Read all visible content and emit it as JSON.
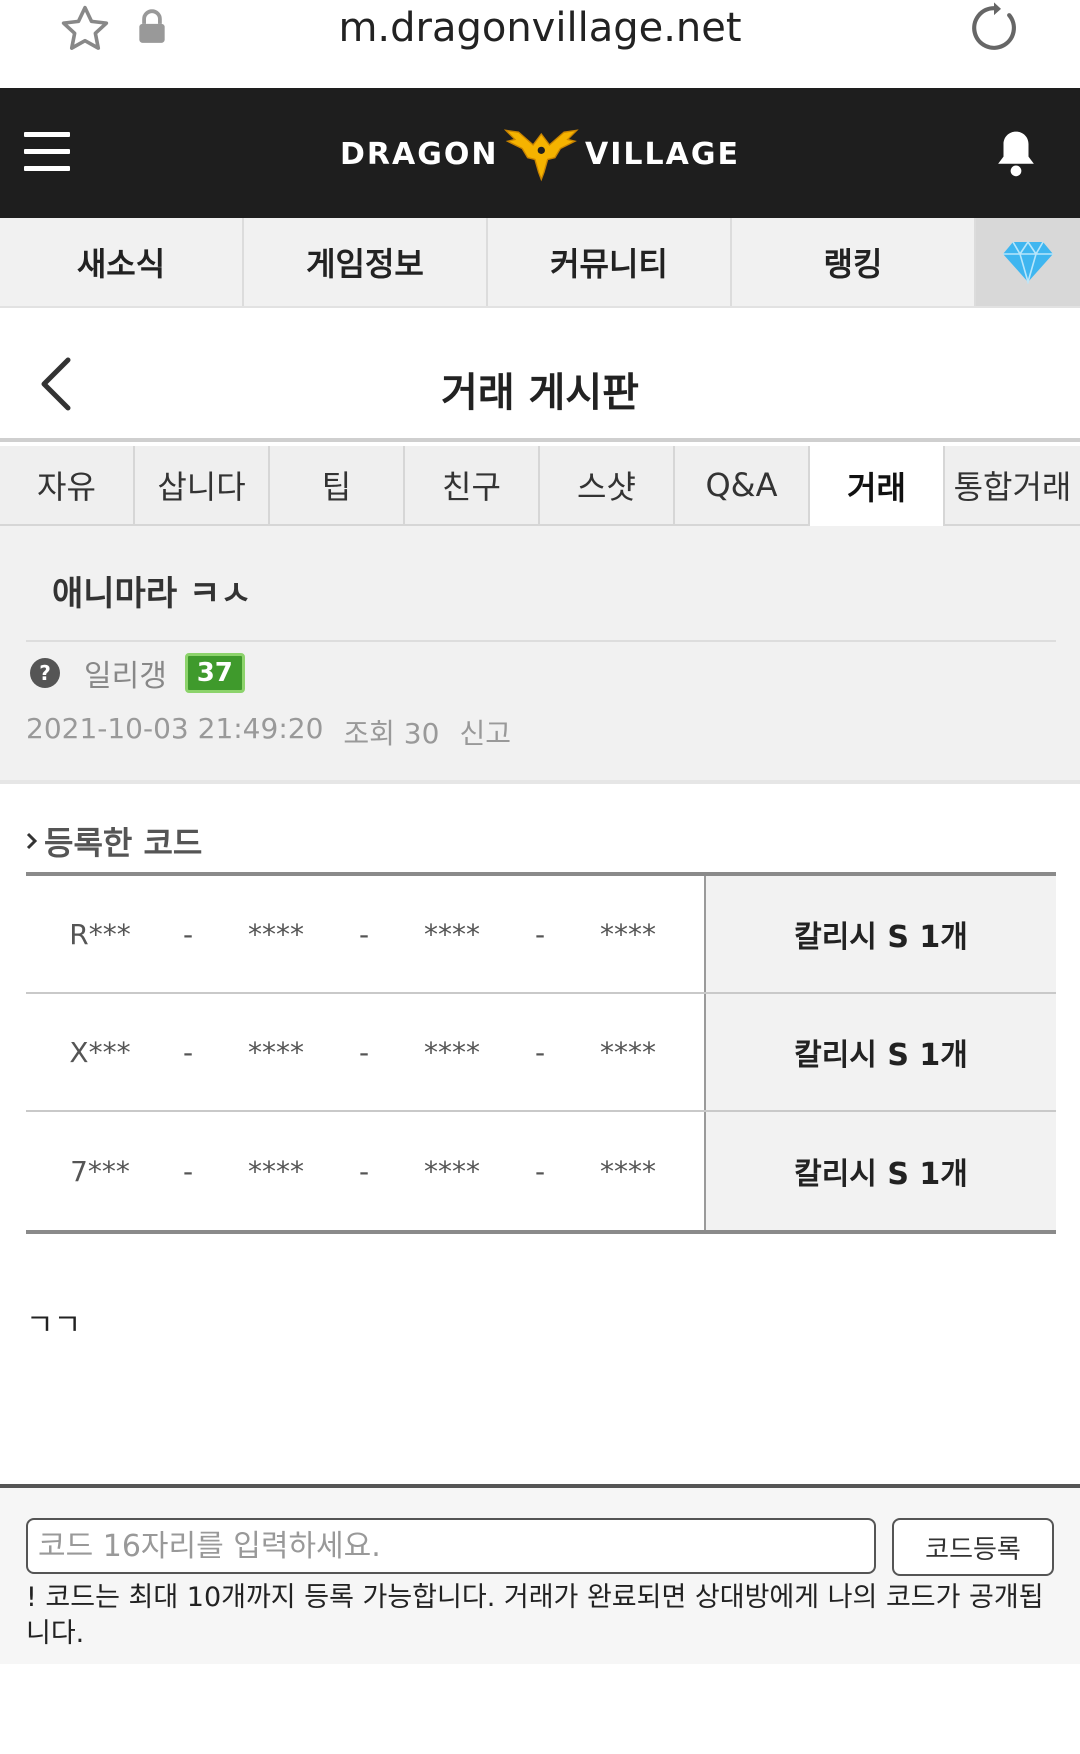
{
  "browser": {
    "url": "m.dragonvillage.net"
  },
  "header": {
    "logo_left": "DRAGON",
    "logo_right": "VILLAGE"
  },
  "main_nav": {
    "items": [
      "새소식",
      "게임정보",
      "커뮤니티",
      "랭킹"
    ]
  },
  "page": {
    "title": "거래 게시판"
  },
  "board_tabs": {
    "items": [
      "자유",
      "삽니다",
      "팁",
      "친구",
      "스샷",
      "Q&A",
      "거래",
      "통합거래"
    ],
    "active": "거래"
  },
  "post": {
    "title": "애니마라 ㅋㅅ",
    "author": "일리갱",
    "level": "37",
    "datetime": "2021-10-03 21:49:20",
    "views": "조회 30",
    "report": "신고",
    "body": "ㄱㄱ"
  },
  "codes": {
    "label": "등록한 코드",
    "rows": [
      {
        "seg1": "R***",
        "seg2": "****",
        "seg3": "****",
        "seg4": "****",
        "dash": "-",
        "reward": "칼리시 S 1개"
      },
      {
        "seg1": "X***",
        "seg2": "****",
        "seg3": "****",
        "seg4": "****",
        "dash": "-",
        "reward": "칼리시 S 1개"
      },
      {
        "seg1": "7***",
        "seg2": "****",
        "seg3": "****",
        "seg4": "****",
        "dash": "-",
        "reward": "칼리시 S 1개"
      }
    ]
  },
  "code_form": {
    "placeholder": "코드 16자리를 입력하세요.",
    "value": "",
    "button": "코드등록",
    "note": "! 코드는 최대 10개까지 등록 가능합니다. 거래가 완료되면 상대방에게 나의 코드가 공개됩니다."
  },
  "icons": {
    "bookmark": "star-icon",
    "secure": "lock-icon",
    "reload": "reload-icon",
    "menu": "hamburger-menu-icon",
    "notifications": "bell-icon",
    "premium": "diamond-icon",
    "back": "chevron-left-icon",
    "author_badge": "question-icon"
  },
  "colors": {
    "header_bg": "#1e1e1e",
    "logo_emblem": "#f5b300",
    "level_badge": "#3f9a2c",
    "diamond": "#3fb6f0"
  }
}
